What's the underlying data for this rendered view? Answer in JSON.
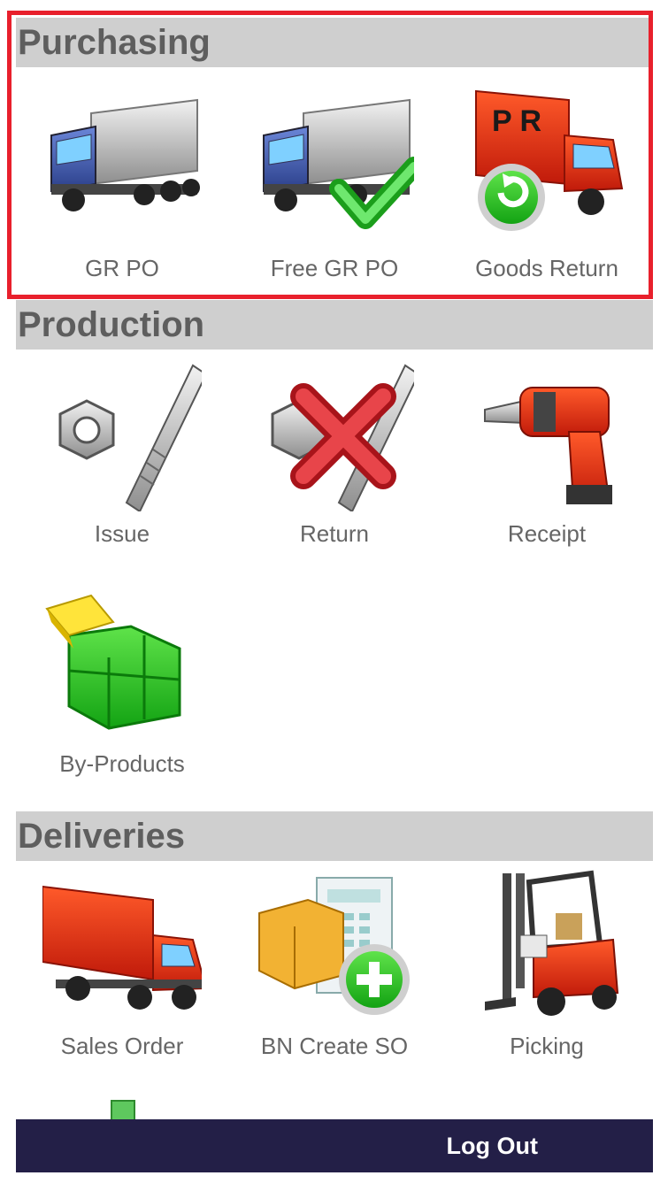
{
  "colors": {
    "highlight": "#e8202c",
    "header_bg": "#cfcfcf",
    "header_text": "#5e5e5e",
    "logout_bg": "#231f47"
  },
  "sections": {
    "purchasing": {
      "title": "Purchasing",
      "items": [
        "GR PO",
        "Free GR PO",
        "Goods Return"
      ]
    },
    "production": {
      "title": "Production",
      "items": [
        "Issue",
        "Return",
        "Receipt",
        "By-Products"
      ]
    },
    "deliveries": {
      "title": "Deliveries",
      "items": [
        "Sales Order",
        "BN Create SO",
        "Picking"
      ]
    }
  },
  "icons": {
    "gr_po": "truck-icon",
    "free_gr_po": "truck-check-icon",
    "goods_return": "return-truck-icon",
    "issue": "bolt-nut-icon",
    "return": "bolt-nut-cross-icon",
    "receipt": "drill-icon",
    "by_products": "cubes-icon",
    "sales_order": "red-truck-icon",
    "bn_create_so": "crate-add-icon",
    "picking": "forklift-icon"
  },
  "goods_return_mark": "P R",
  "logout": {
    "label": "Log Out"
  }
}
